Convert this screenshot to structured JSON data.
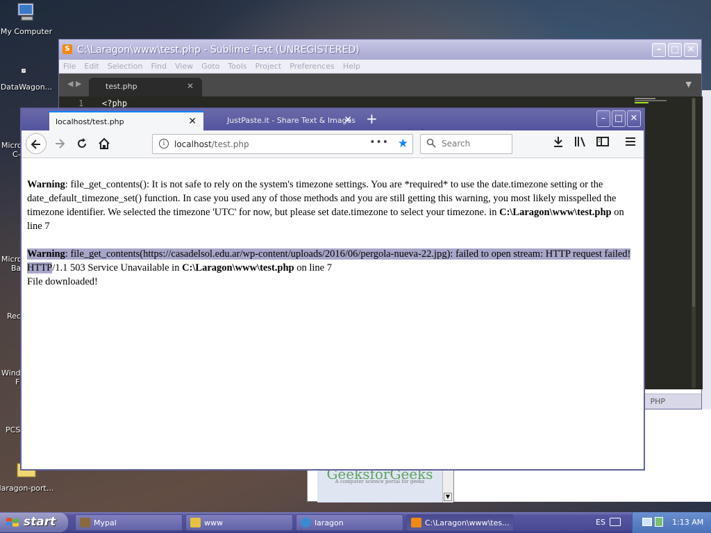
{
  "desktop": {
    "icons": [
      {
        "label": "My Computer"
      },
      {
        "label": "DataWagon..."
      },
      {
        "label": "laragon-port..."
      }
    ],
    "partial_labels": [
      "Micro",
      "C-",
      "Micro",
      "Ba",
      "Rec",
      "Windo",
      "F",
      "PCS"
    ]
  },
  "sublime": {
    "title": "C:\\Laragon\\www\\test.php - Sublime Text (UNREGISTERED)",
    "menu": [
      "File",
      "Edit",
      "Selection",
      "Find",
      "View",
      "Goto",
      "Tools",
      "Project",
      "Preferences",
      "Help"
    ],
    "tab": "test.php",
    "line_number": "1",
    "code_line": "<?php",
    "syntax": "PHP"
  },
  "background_page": {
    "brand": "GeeksforGeeks",
    "tagline": "A computer science portal for geeks"
  },
  "firefox": {
    "tabs": [
      {
        "label": "localhost/test.php",
        "active": true
      },
      {
        "label": "JustPaste.it - Share Text & Images",
        "active": false
      }
    ],
    "url_host": "localhost",
    "url_path": "/test.php",
    "search_placeholder": "Search",
    "content": {
      "warning1": {
        "label": "Warning",
        "text": ": file_get_contents(): It is not safe to rely on the system's timezone settings. You are *required* to use the date.timezone setting or the date_default_timezone_set() function. In case you used any of those methods and you are still getting this warning, you most likely misspelled the timezone identifier. We selected the timezone 'UTC' for now, but please set date.timezone to select your timezone. in ",
        "file": "C:\\Laragon\\www\\test.php",
        "line_text": " on line ",
        "line": "7"
      },
      "warning2": {
        "label": "Warning",
        "text_highlighted": ": file_get_contents(https://casadelsol.edu.ar/wp-content/uploads/2016/06/pergola-nueva-22.jpg): failed to open stream: HTTP request failed! HTTP",
        "text_rest": "/1.1 503 Service Unavailable in ",
        "file": "C:\\Laragon\\www\\test.php",
        "line_text": " on line ",
        "line": "7"
      },
      "downloaded": "File downloaded!"
    }
  },
  "taskbar": {
    "start": "start",
    "tasks": [
      {
        "label": "Mypal",
        "color": "#8a6a3a"
      },
      {
        "label": "www",
        "color": "#e8c040"
      },
      {
        "label": "laragon",
        "color": "#3a8ad0"
      },
      {
        "label": "C:\\Laragon\\www\\tes...",
        "color": "#f08a10"
      }
    ],
    "lang": "ES",
    "time": "1:13 AM"
  }
}
